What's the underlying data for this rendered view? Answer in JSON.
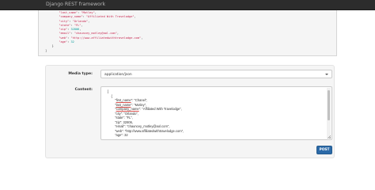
{
  "navbar": {
    "brand": "Django REST framework"
  },
  "response": {
    "lines": [
      {
        "key": "\"last_name\"",
        "value": "\"Motley\""
      },
      {
        "key": "\"company_name\"",
        "value": "\"Affiliated With Travelodge\""
      },
      {
        "key": "\"city\"",
        "value": "\"Orlando\""
      },
      {
        "key": "\"state\"",
        "value": "\"FL\""
      },
      {
        "key": "\"zip\"",
        "value": "32806"
      },
      {
        "key": "\"email\"",
        "value": "\"chauncey_motley@aol.com\""
      },
      {
        "key": "\"web\"",
        "value": "\"http://www.affiliatedwithtravelodge.com\""
      },
      {
        "key": "\"age\"",
        "value": "32"
      }
    ],
    "close_object": "}",
    "close_array": "]"
  },
  "form": {
    "media_type_label": "Media type:",
    "media_type_value": "application/json",
    "content_label": "Content:",
    "content_lines": [
      "[",
      "    {",
      "        \"first_name\": \"Chanel\",",
      "        \"last_name\": \"Motley\",",
      "        \"company_name\": \"Affiliated With Travelodge\",",
      "        \"city\": \"Orlando\",",
      "        \"state\": \"FL\",",
      "        \"zip\": 32806,",
      "        \"email\": \"chauncey_motley@aol.com\",",
      "        \"web\": \"http://www.affiliatedwithtravelodge.com\",",
      "        \"age\": 32"
    ],
    "post_label": "POST"
  },
  "colors": {
    "navbar": "#2c2c2c",
    "button": "#2c6aa8",
    "json_key": "#c7254e"
  },
  "icons": {
    "select_caret": "chevron-down-icon"
  }
}
